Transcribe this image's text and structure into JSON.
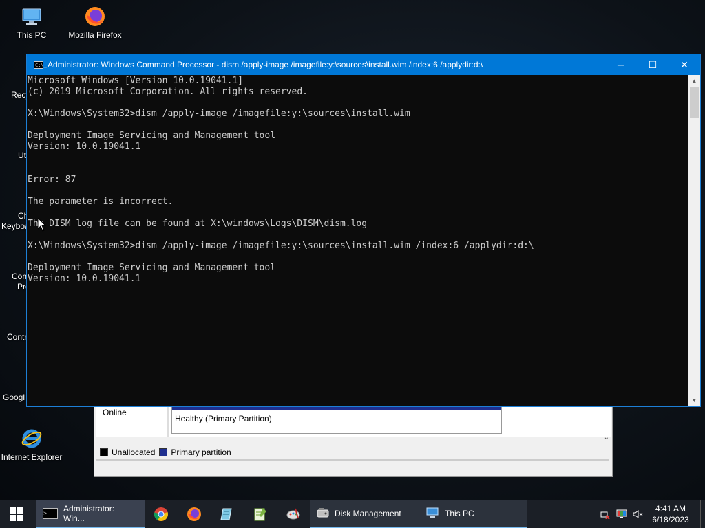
{
  "desktop": {
    "icons": [
      {
        "label": "This PC",
        "icon": "this-pc-icon"
      },
      {
        "label": "Mozilla Firefox",
        "icon": "firefox-icon"
      },
      {
        "label": "Internet Explorer",
        "icon": "internet-explorer-icon"
      }
    ],
    "partial_labels": [
      "Recy",
      "Ut",
      "Ch",
      "Keyboa",
      "Con",
      "Pro",
      "Contr",
      "Googl"
    ]
  },
  "cmd_window": {
    "title": "Administrator: Windows Command Processor - dism  /apply-image /imagefile:y:\\sources\\install.wim /index:6 /applydir:d:\\",
    "icon_text": "C:\\_",
    "buttons": {
      "minimize": "─",
      "maximize": "☐",
      "close": "✕"
    },
    "lines": [
      "Microsoft Windows [Version 10.0.19041.1]",
      "(c) 2019 Microsoft Corporation. All rights reserved.",
      "",
      "X:\\Windows\\System32>dism /apply-image /imagefile:y:\\sources\\install.wim",
      "",
      "Deployment Image Servicing and Management tool",
      "Version: 10.0.19041.1",
      "",
      "",
      "Error: 87",
      "",
      "The parameter is incorrect.",
      "",
      "The DISM log file can be found at X:\\windows\\Logs\\DISM\\dism.log",
      "",
      "X:\\Windows\\System32>dism /apply-image /imagefile:y:\\sources\\install.wim /index:6 /applydir:d:\\",
      "",
      "Deployment Image Servicing and Management tool",
      "Version: 10.0.19041.1"
    ]
  },
  "disk_management": {
    "disk_status": "Online",
    "partition_status": "Healthy (Primary Partition)",
    "legend": [
      {
        "label": "Unallocated",
        "color": "#000000"
      },
      {
        "label": "Primary partition",
        "color": "#1f2f8f"
      }
    ]
  },
  "taskbar": {
    "tasks": [
      {
        "label": "Administrator: Win...",
        "icon": "cmd-icon",
        "state": "active"
      },
      {
        "label": "Disk Management",
        "icon": "disk-management-icon",
        "state": "open"
      },
      {
        "label": "This PC",
        "icon": "this-pc-icon",
        "state": "open"
      }
    ],
    "pinned": [
      "chrome-icon",
      "firefox-icon",
      "notepad-icon",
      "notepad-plus-plus-icon",
      "paint-icon"
    ],
    "clock": {
      "time": "4:41 AM",
      "date": "6/18/2023"
    }
  },
  "colors": {
    "titlebar": "#0078d7",
    "console_bg": "#0c0c0c",
    "console_text": "#cccccc",
    "taskbar_bg": "#1b1f26"
  }
}
